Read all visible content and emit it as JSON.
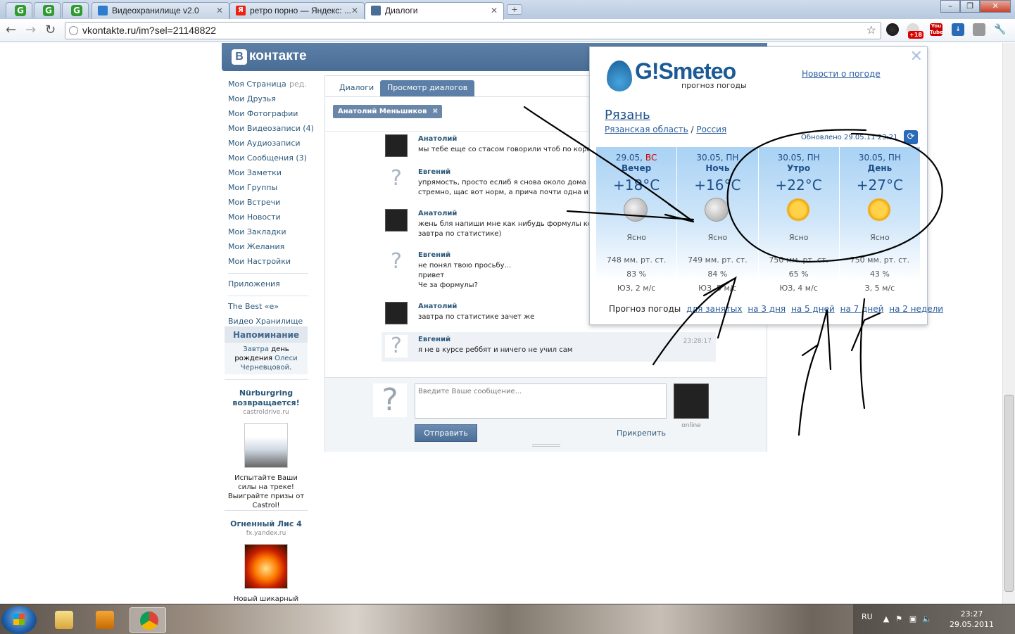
{
  "browser": {
    "tabs": [
      {
        "label": "Видеохранилище v2.0",
        "fav_color": "#2f7ccf"
      },
      {
        "label": "ретро порно — Яндекс: ...",
        "fav_color": "#e21"
      },
      {
        "label": "Диалоги",
        "fav_color": "#4a6d95"
      }
    ],
    "url": "vkontakte.ru/im?sel=21148822",
    "ext_badge": "+18",
    "youtube_label": "You Tube"
  },
  "vk": {
    "logo": "контакте",
    "logo_letter": "В",
    "menu": [
      "Моя Страница",
      "Мои Друзья",
      "Мои Фотографии",
      "Мои Видеозаписи (4)",
      "Мои Аудиозаписи",
      "Мои Сообщения (3)",
      "Мои Заметки",
      "Мои Группы",
      "Мои Встречи",
      "Мои Новости",
      "Мои Закладки",
      "Мои Желания",
      "Мои Настройки"
    ],
    "edit": "ред.",
    "apps": "Приложения",
    "extra_links": [
      "The Best «e»",
      "Видео Хранилище"
    ],
    "reminder": {
      "title": "Напоминание",
      "link1": "Завтра",
      "text1": " день рождения ",
      "link2": "Олеси Черневцовой",
      "text2": "."
    },
    "ads": [
      {
        "title": "Nürburgring возвращается!",
        "site": "castroldrive.ru",
        "text": "Испытайте Ваши силы на треке! Выиграйте призы от Castrol!"
      },
      {
        "title": "Огненный Лис 4",
        "site": "fx.yandex.ru",
        "text": "Новый шикарный"
      }
    ],
    "tabs": [
      "Диалоги",
      "Просмотр диалогов"
    ],
    "chip": "Анатолий Меньшиков",
    "messages": [
      {
        "name": "Анатолий",
        "text": "мы тебе еще со стасом говорили чтоб по короч",
        "time": ""
      },
      {
        "name": "Евгений",
        "text": "упрямость, просто еслиб я снова около дома по\nстремно, щас вот норм, а прича почти одна и та",
        "time": ""
      },
      {
        "name": "Анатолий",
        "text": "жень бля напиши мне как нибудь формулы кото\nзавтра по статистике)",
        "time": ""
      },
      {
        "name": "Евгений",
        "text": "не понял твою просьбу...\nпривет\nЧе за формулы?",
        "time": ""
      },
      {
        "name": "Анатолий",
        "text": "завтра по статистике зачет же",
        "time": ""
      },
      {
        "name": "Евгений",
        "text": "я не в курсе реббят и ничего не учил сам",
        "time": "23:28:17"
      }
    ],
    "compose": {
      "placeholder": "Введите Ваше сообщение...",
      "send": "Отправить",
      "attach": "Прикрепить",
      "online": "online",
      "question": "?"
    }
  },
  "gismeteo": {
    "brand": "G!Smeteo",
    "subtitle": "прогноз погоды",
    "news": "Новости о погоде",
    "city": "Рязань",
    "region": "Рязанская область",
    "country": "Россия",
    "updated": "Обновлено 29.05.11 23:21",
    "periods": [
      {
        "date": "29.05,",
        "weekday": "ВС",
        "time": "Вечер",
        "temp": "+18°C",
        "icon": "moon-icon",
        "cond": "Ясно",
        "pressure": "748 мм. рт. ст.",
        "humidity": "83 %",
        "wind": "ЮЗ, 2 м/с"
      },
      {
        "date": "30.05,",
        "weekday": "ПН",
        "time": "Ночь",
        "temp": "+16°C",
        "icon": "moon-icon",
        "cond": "Ясно",
        "pressure": "749 мм. рт. ст.",
        "humidity": "84 %",
        "wind": "ЮЗ, 5 м/с"
      },
      {
        "date": "30.05,",
        "weekday": "ПН",
        "time": "Утро",
        "temp": "+22°C",
        "icon": "sun-icon",
        "cond": "Ясно",
        "pressure": "750 мм. рт. ст.",
        "humidity": "65 %",
        "wind": "ЮЗ, 4 м/с"
      },
      {
        "date": "30.05,",
        "weekday": "ПН",
        "time": "День",
        "temp": "+27°C",
        "icon": "sun-icon",
        "cond": "Ясно",
        "pressure": "750 мм. рт. ст.",
        "humidity": "43 %",
        "wind": "З, 5 м/с"
      }
    ],
    "forecast_label": "Прогноз погоды",
    "forecast_links": [
      "для занятых",
      "на 3 дня",
      "на 5 дней",
      "на 7 дней",
      "на 2 недели"
    ]
  },
  "taskbar": {
    "lang": "RU",
    "time": "23:27",
    "date": "29.05.2011"
  }
}
